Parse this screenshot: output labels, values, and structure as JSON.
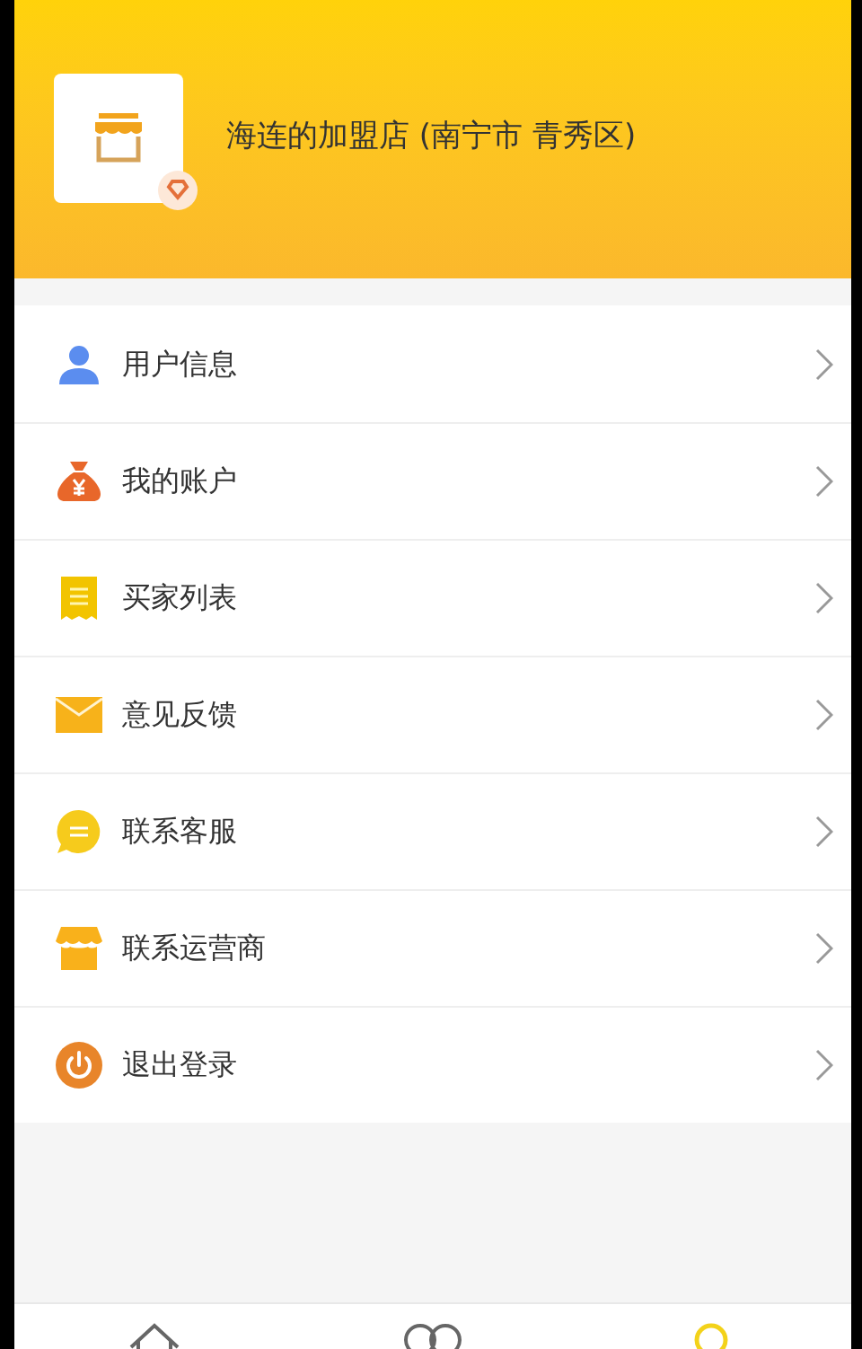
{
  "shop": {
    "title": "海连的加盟店 (南宁市 青秀区)"
  },
  "menu": [
    {
      "kind": "user",
      "label": "用户信息"
    },
    {
      "kind": "account",
      "label": "我的账户"
    },
    {
      "kind": "buyers",
      "label": "买家列表"
    },
    {
      "kind": "feedback",
      "label": "意见反馈"
    },
    {
      "kind": "service",
      "label": "联系客服"
    },
    {
      "kind": "operator",
      "label": "联系运营商"
    },
    {
      "kind": "logout",
      "label": "退出登录"
    }
  ],
  "tabs": [
    {
      "kind": "home",
      "selected": false
    },
    {
      "kind": "community",
      "selected": false
    },
    {
      "kind": "profile",
      "selected": true
    }
  ]
}
